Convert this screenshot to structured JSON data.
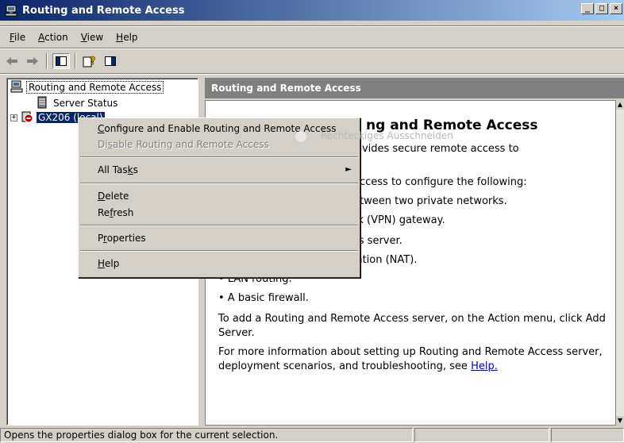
{
  "window": {
    "title": "Routing and Remote Access",
    "min": "_",
    "max": "□",
    "close": "×"
  },
  "menu": [
    {
      "label_pre": "",
      "label_u": "F",
      "label_post": "ile"
    },
    {
      "label_pre": "",
      "label_u": "A",
      "label_post": "ction"
    },
    {
      "label_pre": "",
      "label_u": "V",
      "label_post": "iew"
    },
    {
      "label_pre": "",
      "label_u": "H",
      "label_post": "elp"
    }
  ],
  "tree": {
    "root": "Routing and Remote Access",
    "server_status": "Server Status",
    "server": "GX206 (local)",
    "expander": "+"
  },
  "right": {
    "header": "Routing and Remote Access",
    "heading": "ng and Remote Access",
    "p1": "ess provides secure remote access to",
    "p2": "access to configure the following:",
    "b1": "etween two private networks.",
    "b2": "rk (VPN) gateway.",
    "b3": "ss server.",
    "b4": "lation (NAT).",
    "b5": "• LAN routing.",
    "b6": "• A basic firewall.",
    "p3": "To add a Routing and Remote Access server, on the Action menu, click Add Server.",
    "p4": "For more information about setting up Routing and Remote Access server, deployment scenarios, and troubleshooting, see ",
    "help_link": "Help.",
    "ghost": "Rechteckiges Ausschneiden"
  },
  "context_menu": {
    "configure": {
      "pre": "",
      "u": "C",
      "post": "onfigure and Enable Routing and Remote Access"
    },
    "disable": {
      "pre": "Di",
      "u": "s",
      "post": "able Routing and Remote Access"
    },
    "all_tasks": {
      "pre": "All Tas",
      "u": "k",
      "post": "s"
    },
    "delete": {
      "pre": "",
      "u": "D",
      "post": "elete"
    },
    "refresh": {
      "pre": "Re",
      "u": "f",
      "post": "resh"
    },
    "properties": {
      "pre": "P",
      "u": "r",
      "post": "operties"
    },
    "help": {
      "pre": "",
      "u": "H",
      "post": "elp"
    },
    "submenu_arrow": "►"
  },
  "status": {
    "text": "Opens the properties dialog box for the current selection."
  },
  "colors": {
    "title_start": "#0a246a",
    "title_end": "#a6caf0",
    "selection": "#0a246a"
  }
}
